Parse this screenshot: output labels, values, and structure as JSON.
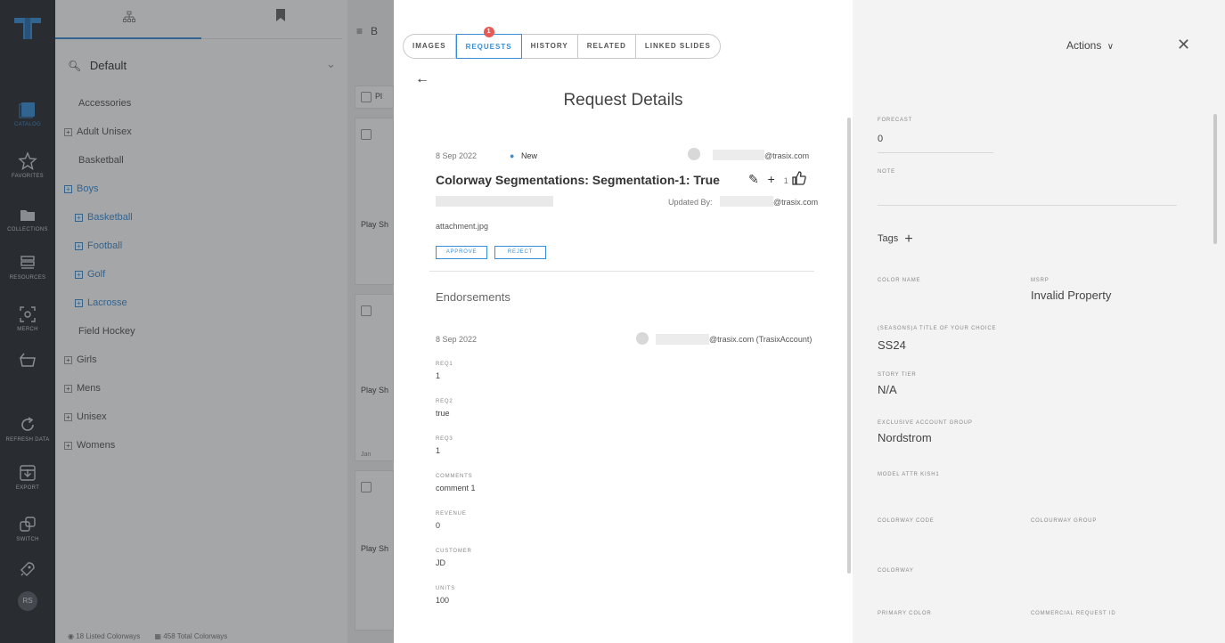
{
  "rail": {
    "items": [
      {
        "name": "catalog",
        "label": "CATALOG",
        "icon": "book-icon"
      },
      {
        "name": "favorites",
        "label": "FAVORITES",
        "icon": "star-icon"
      },
      {
        "name": "collections",
        "label": "COLLECTIONS",
        "icon": "folder-icon"
      },
      {
        "name": "resources",
        "label": "RESOURCES",
        "icon": "stack-icon"
      },
      {
        "name": "merch",
        "label": "MERCH",
        "icon": "merch-icon"
      },
      {
        "name": "cart",
        "label": "",
        "icon": "basket-icon"
      },
      {
        "name": "refresh",
        "label": "REFRESH DATA",
        "icon": "refresh-icon"
      },
      {
        "name": "export",
        "label": "EXPORT",
        "icon": "export-icon"
      },
      {
        "name": "switch",
        "label": "SWITCH",
        "icon": "switch-icon"
      },
      {
        "name": "rocket",
        "label": "",
        "icon": "rocket-icon"
      }
    ],
    "avatar": "RS"
  },
  "catalog": {
    "search_value": "Default",
    "tree": [
      {
        "label": "Accessories",
        "expandable": false,
        "indent": 1,
        "blue": false
      },
      {
        "label": "Adult Unisex",
        "expandable": true,
        "indent": 0,
        "blue": false
      },
      {
        "label": "Basketball",
        "expandable": false,
        "indent": 1,
        "blue": false
      },
      {
        "label": "Boys",
        "expandable": true,
        "indent": 0,
        "blue": true
      },
      {
        "label": "Basketball",
        "expandable": true,
        "indent": 1,
        "blue": true
      },
      {
        "label": "Football",
        "expandable": true,
        "indent": 1,
        "blue": true
      },
      {
        "label": "Golf",
        "expandable": true,
        "indent": 1,
        "blue": true
      },
      {
        "label": "Lacrosse",
        "expandable": true,
        "indent": 1,
        "blue": true
      },
      {
        "label": "Field Hockey",
        "expandable": false,
        "indent": 1,
        "blue": false
      },
      {
        "label": "Girls",
        "expandable": true,
        "indent": 0,
        "blue": false
      },
      {
        "label": "Mens",
        "expandable": true,
        "indent": 0,
        "blue": false
      },
      {
        "label": "Unisex",
        "expandable": true,
        "indent": 0,
        "blue": false
      },
      {
        "label": "Womens",
        "expandable": true,
        "indent": 0,
        "blue": false
      }
    ],
    "grid_header": "B",
    "grid_card_label": "Pl",
    "grid_cards": [
      "Play Sh",
      "Play Sh",
      "Play Sh"
    ],
    "grid_card_sub": "Jan",
    "footer_listed": "18 Listed Colorways",
    "footer_total": "458 Total Colorways"
  },
  "request": {
    "tabs": [
      {
        "label": "IMAGES",
        "active": false,
        "badge": ""
      },
      {
        "label": "REQUESTS",
        "active": true,
        "badge": "1"
      },
      {
        "label": "HISTORY",
        "active": false,
        "badge": ""
      },
      {
        "label": "RELATED",
        "active": false,
        "badge": ""
      },
      {
        "label": "LINKED SLIDES",
        "active": false,
        "badge": ""
      }
    ],
    "title": "Request Details",
    "date": "8 Sep 2022",
    "status": "New",
    "requester_email": "@trasix.com",
    "segment_title": "Colorway Segmentations: Segmentation-1: True",
    "like_count": "1",
    "updated_by_label": "Updated By:",
    "updated_by_email": "@trasix.com",
    "attachment": "attachment.jpg",
    "approve_label": "APPROVE",
    "reject_label": "REJECT",
    "endorsements_title": "Endorsements",
    "endorsement_date": "8 Sep 2022",
    "endorsement_email": "@trasix.com (TrasixAccount)",
    "fields": [
      {
        "label": "REQ1",
        "value": "1"
      },
      {
        "label": "REQ2",
        "value": "true"
      },
      {
        "label": "REQ3",
        "value": "1"
      },
      {
        "label": "COMMENTS",
        "value": "comment 1"
      },
      {
        "label": "REVENUE",
        "value": "0"
      },
      {
        "label": "CUSTOMER",
        "value": "JD"
      },
      {
        "label": "UNITS",
        "value": "100"
      }
    ]
  },
  "props": {
    "actions_label": "Actions",
    "forecast_label": "FORECAST",
    "forecast_value": "0",
    "note_label": "NOTE",
    "tags_label": "Tags",
    "color_name_label": "COLOR NAME",
    "msrp_label": "MSRP",
    "msrp_value": "Invalid Property",
    "season_label": "(SEASONS)A TITLE OF YOUR CHOICE",
    "season_value": "SS24",
    "story_tier_label": "STORY TIER",
    "story_tier_value": "N/A",
    "exclusive_label": "EXCLUSIVE ACCOUNT GROUP",
    "exclusive_value": "Nordstrom",
    "model_attr_label": "MODEL ATTR KISH1",
    "colorway_code_label": "COLORWAY CODE",
    "colourway_group_label": "COLOURWAY GROUP",
    "colorway_label": "COLORWAY",
    "primary_color_label": "PRIMARY COLOR",
    "commercial_request_label": "COMMERCIAL REQUEST ID"
  },
  "colors": {
    "accent": "#3a8ed8",
    "rail": "#2a2f36",
    "badge": "#e65b55"
  }
}
